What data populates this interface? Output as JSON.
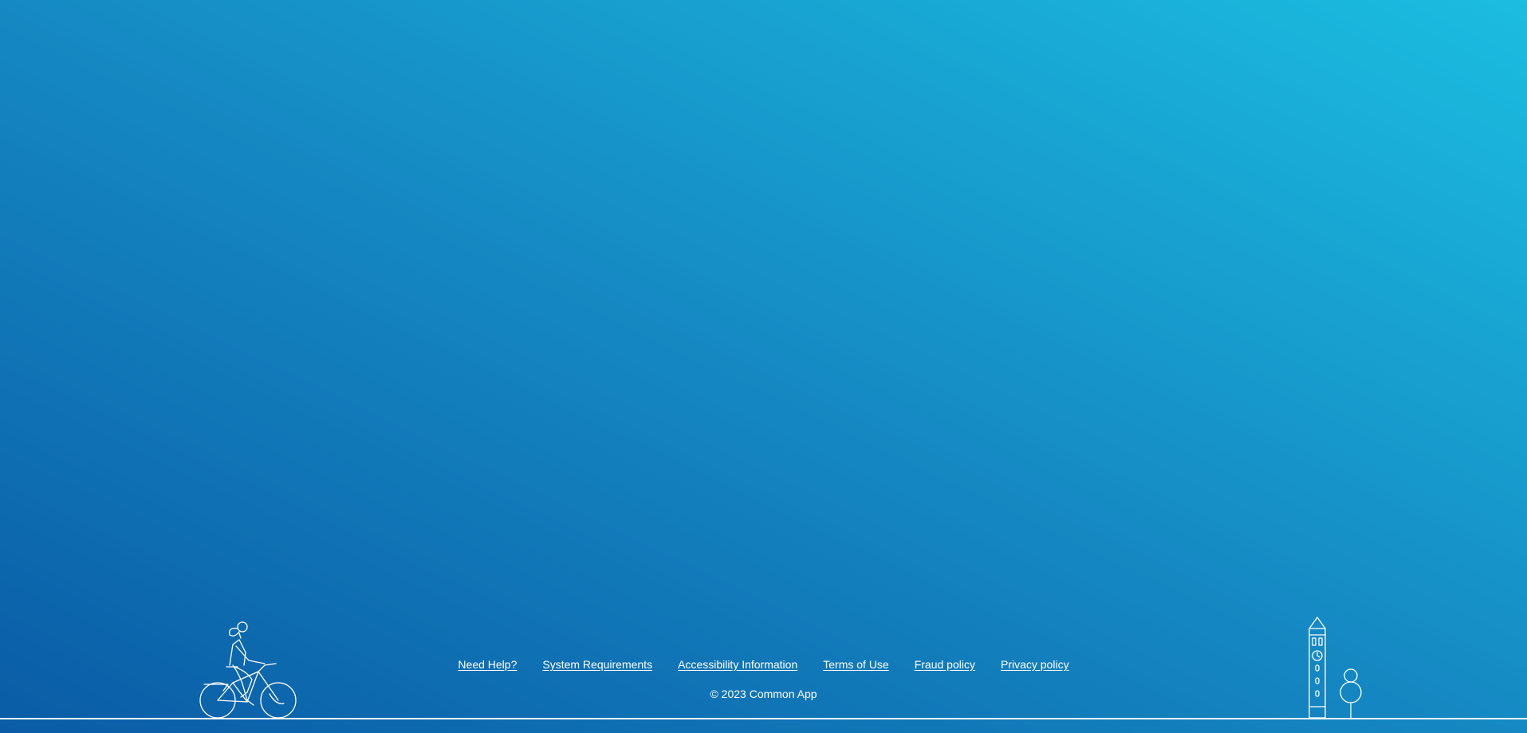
{
  "footer": {
    "links": [
      {
        "label": "Need Help?"
      },
      {
        "label": "System Requirements"
      },
      {
        "label": "Accessibility Information"
      },
      {
        "label": "Terms of Use"
      },
      {
        "label": "Fraud policy"
      },
      {
        "label": "Privacy policy"
      }
    ],
    "copyright": "© 2023 Common App"
  },
  "illustrations": {
    "left": "cyclist-illustration",
    "right": "clock-tower-and-tree-illustration"
  },
  "colors": {
    "gradient_start": "#0a5ca6",
    "gradient_mid": "#1589c3",
    "gradient_end": "#1bbde0",
    "line_art": "#ffffff"
  }
}
